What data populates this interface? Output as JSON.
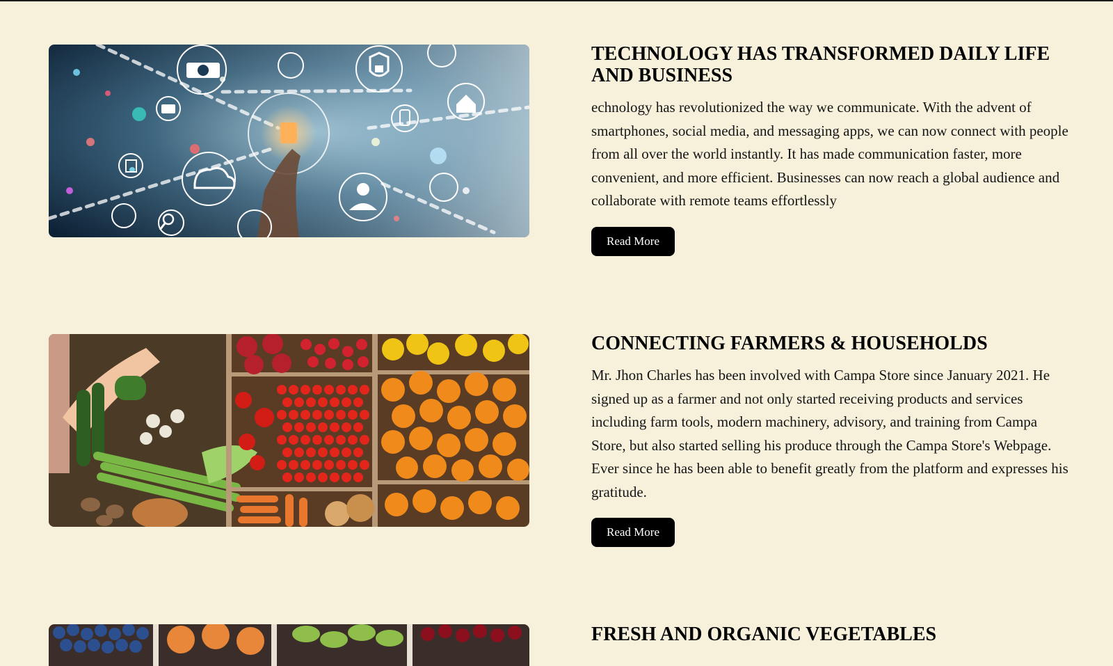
{
  "articles": [
    {
      "image_desc_icon": "technology-image",
      "title": "TECHNOLOGY HAS TRANSFORMED DAILY LIFE AND BUSINESS",
      "body": "echnology has revolutionized the way we communicate. With the advent of smartphones, social media, and messaging apps, we can now connect with people from all over the world instantly. It has made communication faster, more convenient, and more efficient. Businesses can now reach a global audience and collaborate with remote teams effortlessly",
      "button": "Read More"
    },
    {
      "image_desc_icon": "produce-crates-image",
      "title": "CONNECTING FARMERS & HOUSEHOLDS",
      "body": "Mr. Jhon Charles has been involved with Campa Store since January 2021. He signed up as a farmer and not only started receiving products and services including farm tools, modern machinery, advisory, and training from Campa Store, but also started selling his produce through the Campa Store's Webpage. Ever since he has been able to benefit greatly from the platform and expresses his gratitude.",
      "button": "Read More"
    },
    {
      "image_desc_icon": "fruit-bowls-image",
      "title": "FRESH AND ORGANIC VEGETABLES"
    }
  ],
  "colors": {
    "page_background": "#f7f1dc",
    "button_background": "#000000",
    "button_text": "#ffffff"
  }
}
